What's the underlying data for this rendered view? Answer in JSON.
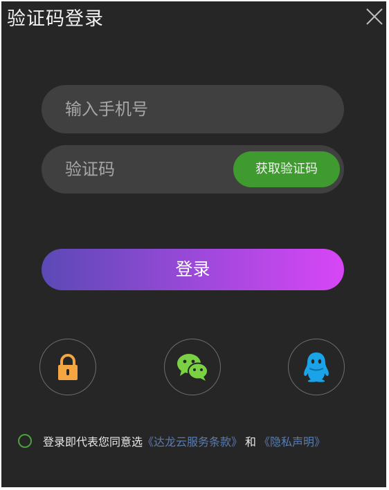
{
  "dialog": {
    "title": "验证码登录"
  },
  "phone": {
    "placeholder": "输入手机号",
    "value": ""
  },
  "code": {
    "placeholder": "验证码",
    "value": "",
    "get_code_label": "获取验证码"
  },
  "login": {
    "label": "登录"
  },
  "social": [
    {
      "icon": "lock-icon",
      "color": "#f4a640"
    },
    {
      "icon": "wechat-icon",
      "color": "#7bd144"
    },
    {
      "icon": "qq-icon",
      "color": "#1aa3e8"
    }
  ],
  "agreement": {
    "text": "登录即代表您同意选",
    "terms_link": "《达龙云服务条款》",
    "and": "和",
    "privacy_link": "《隐私声明》"
  },
  "colors": {
    "background": "#262626",
    "field": "#404040",
    "accent_green": "#3f9a30",
    "link": "#5b7cb0",
    "gradient_start": "#5b49b6",
    "gradient_end": "#d846f6"
  }
}
